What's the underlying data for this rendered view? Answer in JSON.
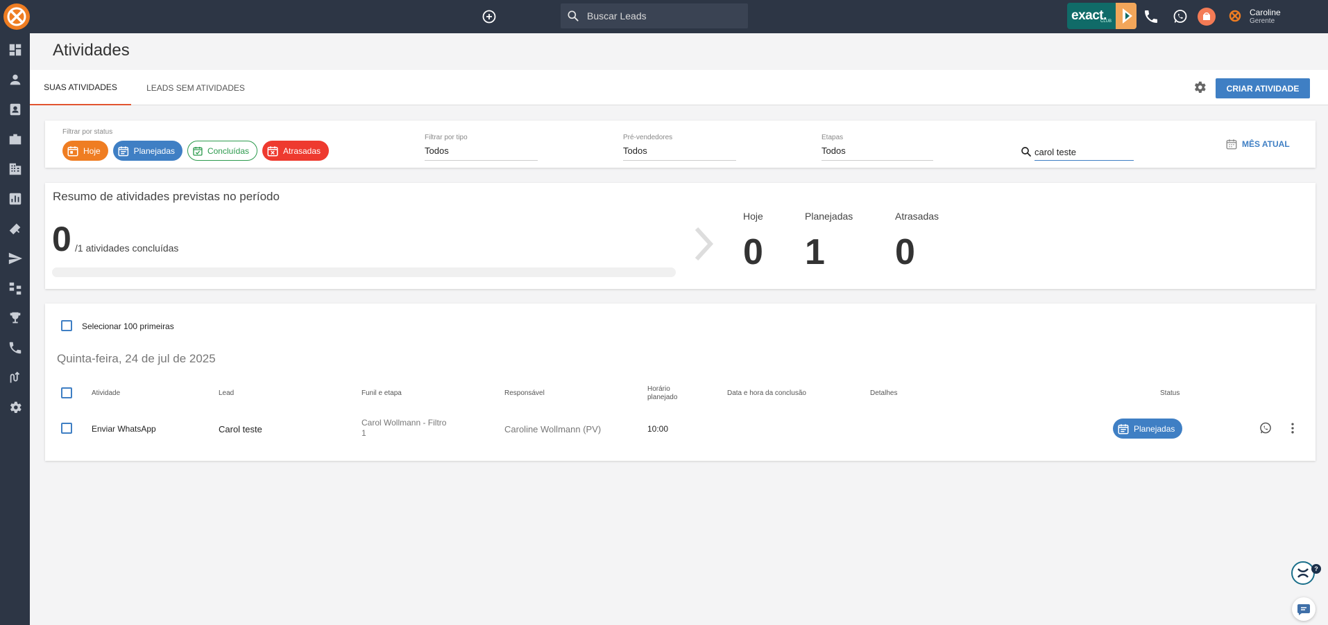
{
  "topbar": {
    "search_placeholder": "Buscar Leads",
    "exact_club": "exact.",
    "exact_club_sub": "CLUB",
    "user_name": "Caroline",
    "user_role": "Gerente"
  },
  "sidebar": {
    "items": [
      "dashboard-icon",
      "person-icon",
      "contact-card-icon",
      "briefcase-icon",
      "building-icon",
      "chart-icon",
      "megaphone-icon",
      "send-icon",
      "flow-icon",
      "trophy-icon",
      "phone-icon",
      "route-icon",
      "gear-icon"
    ]
  },
  "page": {
    "title": "Atividades"
  },
  "tabs": {
    "suas_atividades": "SUAS ATIVIDADES",
    "leads_sem_atividades": "LEADS SEM ATIVIDADES",
    "create_button": "CRIAR ATIVIDADE"
  },
  "filters": {
    "status_label": "Filtrar por status",
    "chips": {
      "hoje": "Hoje",
      "planejadas": "Planejadas",
      "concluidas": "Concluídas",
      "atrasadas": "Atrasadas"
    },
    "tipo_label": "Filtrar por tipo",
    "tipo_value": "Todos",
    "prevendedores_label": "Pré-vendedores",
    "prevendedores_value": "Todos",
    "etapas_label": "Etapas",
    "etapas_value": "Todos",
    "search_value": "carol teste",
    "mes_atual": "MÊS ATUAL"
  },
  "summary": {
    "title": "Resumo de atividades previstas no período",
    "concluded_count": "0",
    "concluded_text": "/1 atividades concluídas",
    "progress": 0,
    "stats": [
      {
        "label": "Hoje",
        "value": "0"
      },
      {
        "label": "Planejadas",
        "value": "1"
      },
      {
        "label": "Atrasadas",
        "value": "0"
      }
    ]
  },
  "list": {
    "select_label": "Selecionar 100 primeiras",
    "date_heading": "Quinta-feira, 24 de jul de 2025",
    "columns": {
      "atividade": "Atividade",
      "lead": "Lead",
      "funil": "Funil e etapa",
      "responsavel": "Responsável",
      "horario_1": "Horário",
      "horario_2": "planejado",
      "conclusao": "Data e hora da conclusão",
      "detalhes": "Detalhes",
      "status": "Status"
    },
    "rows": [
      {
        "atividade": "Enviar WhatsApp",
        "lead": "Carol teste",
        "funil_1": "Carol Wollmann - Filtro",
        "funil_2": "1",
        "responsavel": "Caroline Wollmann (PV)",
        "horario": "10:00",
        "status": "Planejadas"
      }
    ]
  },
  "floating": {
    "help_badge": "?"
  },
  "colors": {
    "topbar": "#2d3645",
    "accent_blue": "#3f7fc4",
    "orange": "#ef7d22",
    "green": "#2c9a4d",
    "red": "#ee3a2f"
  }
}
